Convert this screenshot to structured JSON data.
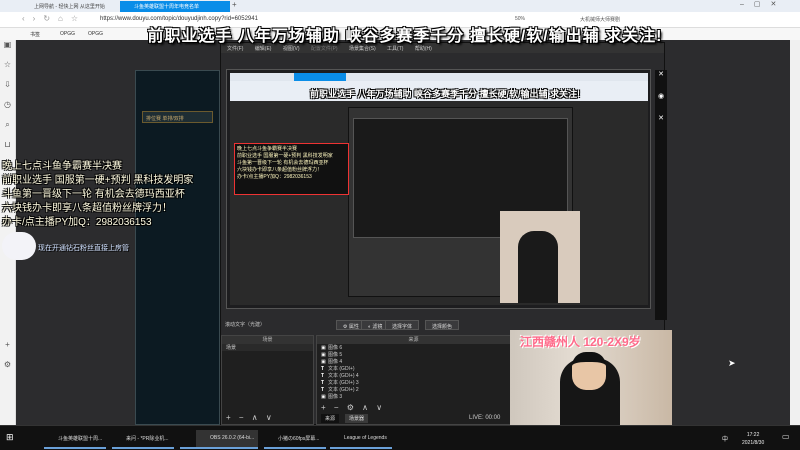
{
  "browser": {
    "tabs": [
      {
        "label": "上网导航 - 轻快上网 从这里开始"
      },
      {
        "label": "斗鱼英雄联盟十周年电竞名单"
      }
    ],
    "url": "https://www.douyu.com/topic/douyudjinh.copy?rid=6052941",
    "zoom": "50%",
    "search_hint": "大机械师大师赛剧",
    "bookmarks": [
      "书签",
      "OPGG",
      "OPGG"
    ],
    "sidebar_icons": [
      "browser-icon",
      "star-icon",
      "download-icon",
      "history-icon",
      "search-icon",
      "cart-icon",
      "game-icon",
      "plus-icon",
      "settings-icon"
    ]
  },
  "stream": {
    "title_banner": "前职业选手 八年万场辅助 峡谷多赛季千分 擅长硬/软/输出辅 求关注!",
    "overlay_lines": [
      "晚上七点斗鱼争霸赛半决赛",
      "前职业选手 国服第一硬+预判 黑科技发明家",
      "斗鱼第一晋级下一轮 有机会去德玛西亚杯",
      "六块钱办卡即享八条超值粉丝牌浮力！",
      "办卡/点主播PY加Q：2982036153"
    ],
    "diamond_notice": "现在开通钻石粉丝直接上房管",
    "cam_caption": "江西赣州人 120-2X9岁"
  },
  "lol_client": {
    "label": "排位赛 单排/双排"
  },
  "obs": {
    "menu": [
      "文件(F)",
      "编辑(E)",
      "视图(V)",
      "配置文件(P)",
      "场景集合(S)",
      "工具(T)",
      "帮助(H)"
    ],
    "status_label": "滚动文字（光建）",
    "buttons": [
      "属性",
      "滤镜",
      "选择字体",
      "选择颜色"
    ],
    "scenes_header": "场景",
    "scenes": [
      "场景"
    ],
    "sources_header": "来源",
    "sources": [
      {
        "type": "image",
        "label": "图像 6"
      },
      {
        "type": "image",
        "label": "图像 5"
      },
      {
        "type": "image",
        "label": "图像 4"
      },
      {
        "type": "text",
        "label": "文本 (GDI+)"
      },
      {
        "type": "text",
        "label": "文本 (GDI+) 4"
      },
      {
        "type": "text",
        "label": "文本 (GDI+) 3"
      },
      {
        "type": "text",
        "label": "文本 (GDI+) 2"
      },
      {
        "type": "image",
        "label": "图像 3"
      }
    ],
    "source_tabs": [
      "来源",
      "场景器"
    ],
    "live_status": "LIVE: 00:00"
  },
  "taskbar": {
    "items": [
      {
        "label": "斗鱼英雄联盟十周..."
      },
      {
        "label": "来问 - *PR除业机..."
      },
      {
        "label": ""
      },
      {
        "label": "OBS 26.0.2 (64-bi..."
      },
      {
        "label": "小猪の60fps屏幕..."
      },
      {
        "label": "League of Legends"
      }
    ],
    "ime": "中",
    "time": "17:22",
    "date": "2021/8/30"
  }
}
